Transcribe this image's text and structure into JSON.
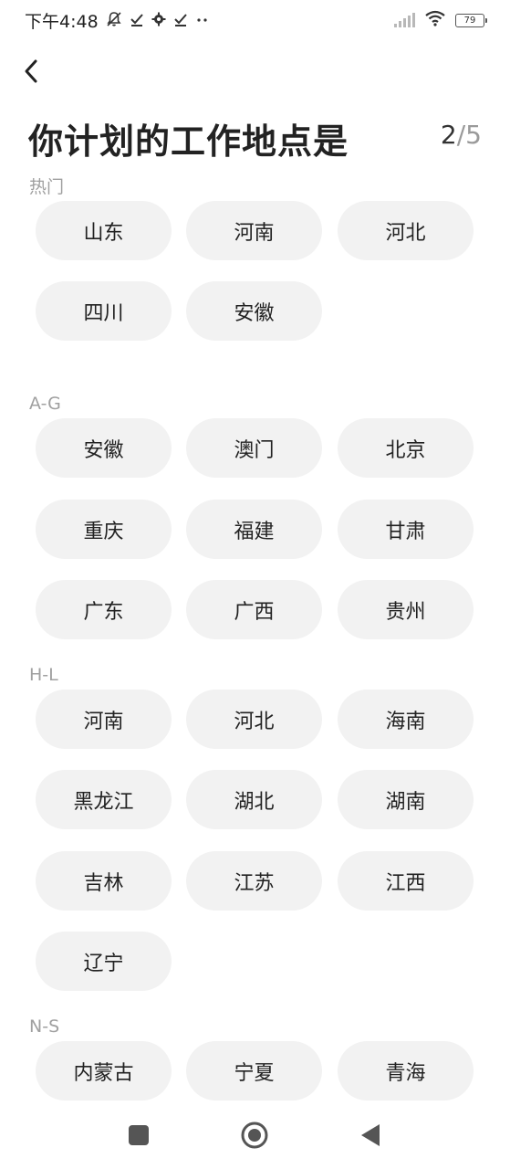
{
  "status_bar": {
    "time": "下午4:48",
    "icons": [
      "bell-off-icon",
      "check-icon",
      "gear-icon",
      "check-icon",
      "more-dots-icon"
    ],
    "battery": "79"
  },
  "header": {
    "back_icon": "chevron-left-icon",
    "title": "你计划的工作地点是",
    "step_current": "2",
    "step_total": "/5"
  },
  "sections": [
    {
      "label": "热门",
      "items": [
        "山东",
        "河南",
        "河北",
        "四川",
        "安徽"
      ]
    },
    {
      "label": "A-G",
      "items": [
        "安徽",
        "澳门",
        "北京",
        "重庆",
        "福建",
        "甘肃",
        "广东",
        "广西",
        "贵州"
      ]
    },
    {
      "label": "H-L",
      "items": [
        "河南",
        "河北",
        "海南",
        "黑龙江",
        "湖北",
        "湖南",
        "吉林",
        "江苏",
        "江西",
        "辽宁"
      ]
    },
    {
      "label": "N-S",
      "items": [
        "内蒙古",
        "宁夏",
        "青海"
      ]
    }
  ],
  "nav_bar": {
    "icons": [
      "recent-apps-icon",
      "home-icon",
      "back-triangle-icon"
    ]
  },
  "colors": {
    "chip_bg": "#f2f2f2",
    "section_label": "#a0a0a0",
    "text": "#222222"
  }
}
